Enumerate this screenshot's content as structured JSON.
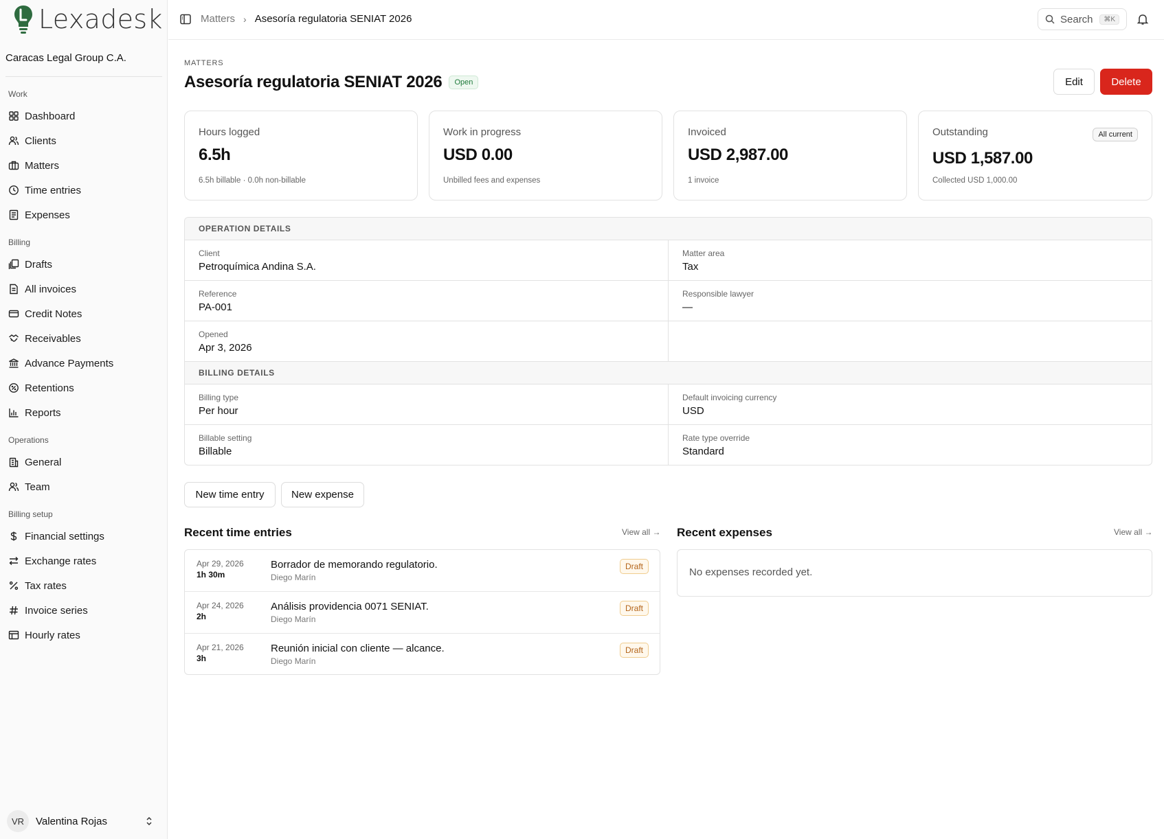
{
  "app": {
    "name": "Lexadesk",
    "organization": "Caracas Legal Group C.A."
  },
  "sidebar": {
    "sections": [
      {
        "title": "Work",
        "items": [
          {
            "label": "Dashboard",
            "icon": "grid-icon"
          },
          {
            "label": "Clients",
            "icon": "users-icon"
          },
          {
            "label": "Matters",
            "icon": "briefcase-icon"
          },
          {
            "label": "Time entries",
            "icon": "clock-icon"
          },
          {
            "label": "Expenses",
            "icon": "receipt-icon"
          }
        ]
      },
      {
        "title": "Billing",
        "items": [
          {
            "label": "Drafts",
            "icon": "drafts-icon"
          },
          {
            "label": "All invoices",
            "icon": "invoice-icon"
          },
          {
            "label": "Credit Notes",
            "icon": "credit-card-icon"
          },
          {
            "label": "Receivables",
            "icon": "handshake-icon"
          },
          {
            "label": "Advance Payments",
            "icon": "bank-icon"
          },
          {
            "label": "Retentions",
            "icon": "badge-percent-icon"
          },
          {
            "label": "Reports",
            "icon": "bar-chart-icon"
          }
        ]
      },
      {
        "title": "Operations",
        "items": [
          {
            "label": "General",
            "icon": "building-icon"
          },
          {
            "label": "Team",
            "icon": "team-icon"
          }
        ]
      },
      {
        "title": "Billing setup",
        "items": [
          {
            "label": "Financial settings",
            "icon": "dollar-icon"
          },
          {
            "label": "Exchange rates",
            "icon": "arrows-exchange-icon"
          },
          {
            "label": "Tax rates",
            "icon": "percent-icon"
          },
          {
            "label": "Invoice series",
            "icon": "hash-icon"
          },
          {
            "label": "Hourly rates",
            "icon": "table-icon"
          }
        ]
      }
    ],
    "user": {
      "initials": "VR",
      "name": "Valentina Rojas"
    }
  },
  "topbar": {
    "breadcrumb_parent": "Matters",
    "breadcrumb_separator": "›",
    "breadcrumb_current": "Asesoría regulatoria SENIAT 2026",
    "search_label": "Search",
    "search_shortcut": "⌘K"
  },
  "header": {
    "eyebrow": "MATTERS",
    "title": "Asesoría regulatoria SENIAT 2026",
    "status": "Open",
    "edit_label": "Edit",
    "delete_label": "Delete"
  },
  "stats": [
    {
      "label": "Hours logged",
      "value": "6.5h",
      "sub": "6.5h billable · 0.0h non-billable"
    },
    {
      "label": "Work in progress",
      "value": "USD 0.00",
      "sub": "Unbilled fees and expenses"
    },
    {
      "label": "Invoiced",
      "value": "USD 2,987.00",
      "sub": "1 invoice"
    },
    {
      "label": "Outstanding",
      "value": "USD 1,587.00",
      "sub": "Collected USD 1,000.00",
      "pill": "All current"
    }
  ],
  "operation_details": {
    "heading": "OPERATION DETAILS",
    "client_label": "Client",
    "client": "Petroquímica Andina S.A.",
    "area_label": "Matter area",
    "area": "Tax",
    "reference_label": "Reference",
    "reference": "PA-001",
    "lawyer_label": "Responsible lawyer",
    "lawyer": "—",
    "opened_label": "Opened",
    "opened": "Apr 3, 2026"
  },
  "billing_details": {
    "heading": "BILLING DETAILS",
    "billing_type_label": "Billing type",
    "billing_type": "Per hour",
    "currency_label": "Default invoicing currency",
    "currency": "USD",
    "billable_label": "Billable setting",
    "billable": "Billable",
    "rate_label": "Rate type override",
    "rate": "Standard"
  },
  "actions": {
    "new_time_entry": "New time entry",
    "new_expense": "New expense"
  },
  "recent_time_entries": {
    "title": "Recent time entries",
    "view_all": "View all →",
    "entries": [
      {
        "date": "Apr 29, 2026",
        "duration": "1h 30m",
        "description": "Borrador de memorando regulatorio.",
        "author": "Diego Marín",
        "status": "Draft"
      },
      {
        "date": "Apr 24, 2026",
        "duration": "2h",
        "description": "Análisis providencia 0071 SENIAT.",
        "author": "Diego Marín",
        "status": "Draft"
      },
      {
        "date": "Apr 21, 2026",
        "duration": "3h",
        "description": "Reunión inicial con cliente — alcance.",
        "author": "Diego Marín",
        "status": "Draft"
      }
    ]
  },
  "recent_expenses": {
    "title": "Recent expenses",
    "view_all": "View all →",
    "empty_text": "No expenses recorded yet."
  },
  "colors": {
    "brand_green": "#2e6b3f",
    "danger": "#d9261c",
    "open_badge": "#1f7a3a",
    "draft_badge": "#b3641a"
  }
}
